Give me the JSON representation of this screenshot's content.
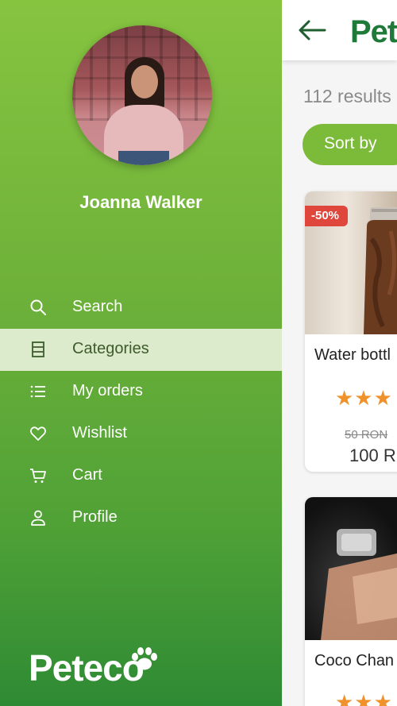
{
  "user": {
    "name": "Joanna Walker"
  },
  "menu": {
    "items": [
      {
        "label": "Search",
        "icon": "search-icon",
        "active": false
      },
      {
        "label": "Categories",
        "icon": "categories-icon",
        "active": true
      },
      {
        "label": "My orders",
        "icon": "list-icon",
        "active": false
      },
      {
        "label": "Wishlist",
        "icon": "heart-icon",
        "active": false
      },
      {
        "label": "Cart",
        "icon": "cart-icon",
        "active": false
      },
      {
        "label": "Profile",
        "icon": "person-icon",
        "active": false
      }
    ]
  },
  "brand": {
    "logo_text": "Peteco",
    "header_title": "Pet"
  },
  "listing": {
    "results_text": "112 results",
    "sort_label": "Sort by",
    "products": [
      {
        "title": "Water bottl",
        "discount": "-50%",
        "stars": "★★★",
        "old_price": "50 RON",
        "new_price": "100 R"
      },
      {
        "title": "Coco Chan",
        "stars": "★★★"
      }
    ]
  },
  "colors": {
    "drawer_top": "#86c440",
    "drawer_bottom": "#2e8a34",
    "active_item": "#dcebcb",
    "accent": "#7cbb3a",
    "brand_dark": "#1f7a3a",
    "discount": "#e0473c",
    "stars": "#f0922b"
  }
}
